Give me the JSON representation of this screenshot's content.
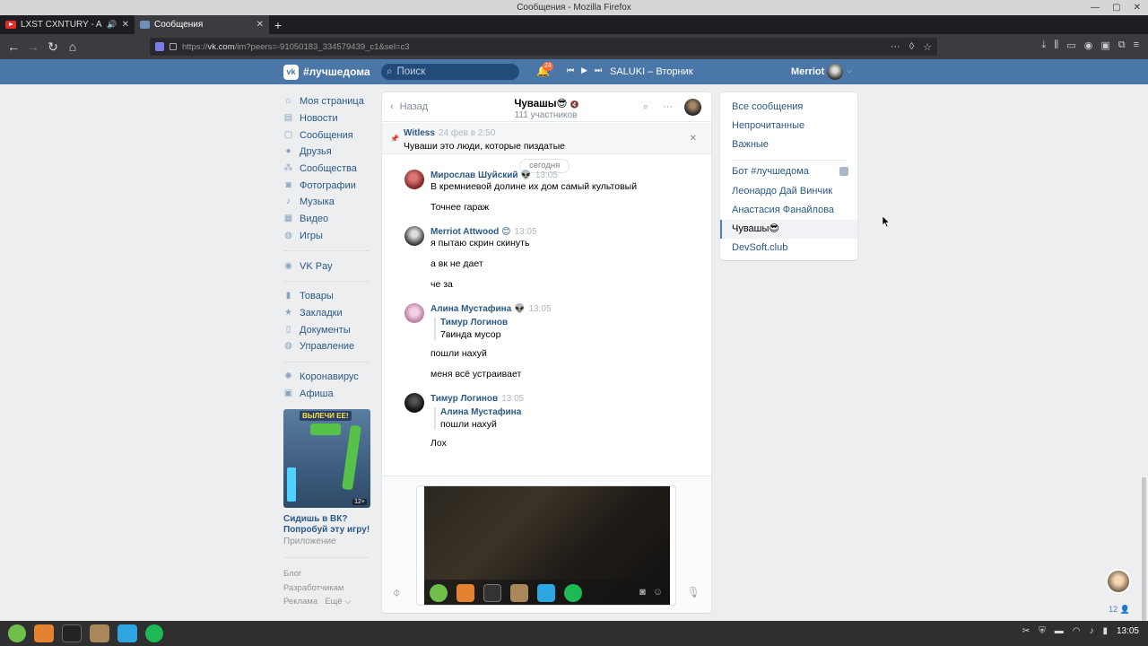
{
  "window": {
    "title": "Сообщения - Mozilla Firefox"
  },
  "tabs": [
    {
      "label": "LXST CXNTURY - ANDRO",
      "active": false
    },
    {
      "label": "Сообщения",
      "active": true
    }
  ],
  "url": {
    "prefix": "https://",
    "host": "vk.com",
    "path": "/im?peers=-91050183_334579439_c1&sel=c3"
  },
  "vk": {
    "brand": "#лучшедома",
    "search_placeholder": "Поиск",
    "notifications_count": "24",
    "track": "SALUKI – Вторник",
    "user_name": "Merriot"
  },
  "menu": {
    "items": [
      {
        "label": "Моя страница",
        "icon": "home-icon"
      },
      {
        "label": "Новости",
        "icon": "news-icon"
      },
      {
        "label": "Сообщения",
        "icon": "messages-icon"
      },
      {
        "label": "Друзья",
        "icon": "friends-icon"
      },
      {
        "label": "Сообщества",
        "icon": "groups-icon"
      },
      {
        "label": "Фотографии",
        "icon": "camera-icon"
      },
      {
        "label": "Музыка",
        "icon": "music-icon"
      },
      {
        "label": "Видео",
        "icon": "video-icon"
      },
      {
        "label": "Игры",
        "icon": "gamepad-icon"
      }
    ],
    "vkpay": "VK Pay",
    "items2": [
      {
        "label": "Товары"
      },
      {
        "label": "Закладки"
      },
      {
        "label": "Документы"
      },
      {
        "label": "Управление"
      }
    ],
    "items3": [
      {
        "label": "Коронавирус"
      },
      {
        "label": "Афиша"
      }
    ]
  },
  "ad": {
    "banner": "ВЫЛЕЧИ ЕЕ!",
    "rating": "12+",
    "title": "Сидишь в ВК? Попробуй эту игру!",
    "subtitle": "Приложение"
  },
  "footer": {
    "blog": "Блог",
    "dev": "Разработчикам",
    "ads": "Реклама",
    "more": "Ещё ⌵"
  },
  "chat": {
    "back": "Назад",
    "title": "Чувашы😎",
    "members": "111 участников",
    "pinned": {
      "author": "Witless",
      "time": "24 фев в 2:50",
      "text": "Чуваши это люди, которые пиздатые"
    },
    "date": "сегодня",
    "messages": [
      {
        "author": "Мирослав Шуйский 👽",
        "time": "13:05",
        "lines": [
          "В кремниевой долине их дом самый культовый",
          "Точнее гараж"
        ]
      },
      {
        "author": "Merriot Attwood 😊",
        "time": "13:05",
        "lines": [
          "я пытаю скрин скинуть",
          "а вк не дает",
          "че за"
        ]
      },
      {
        "author": "Алина Мустафина 👽",
        "time": "13:05",
        "reply_author": "Тимур Логинов",
        "reply_text": "7винда мусор",
        "lines": [
          "пошли нахуй",
          "меня всё устраивает"
        ]
      },
      {
        "author": "Тимур Логинов",
        "time": "13:05",
        "reply_author": "Алина Мустафина",
        "reply_text": "пошли нахуй",
        "lines": [
          "Лох"
        ]
      }
    ]
  },
  "right": {
    "all": "Все сообщения",
    "unread": "Непрочитанные",
    "important": "Важные",
    "convs": [
      "Бот #лучшедома",
      "Леонардо Дай Винчик",
      "Анастасия Фанайлова",
      "Чувашы😎",
      "DevSoft.club"
    ]
  },
  "chat_dock_count": "12",
  "clock": "13:05"
}
